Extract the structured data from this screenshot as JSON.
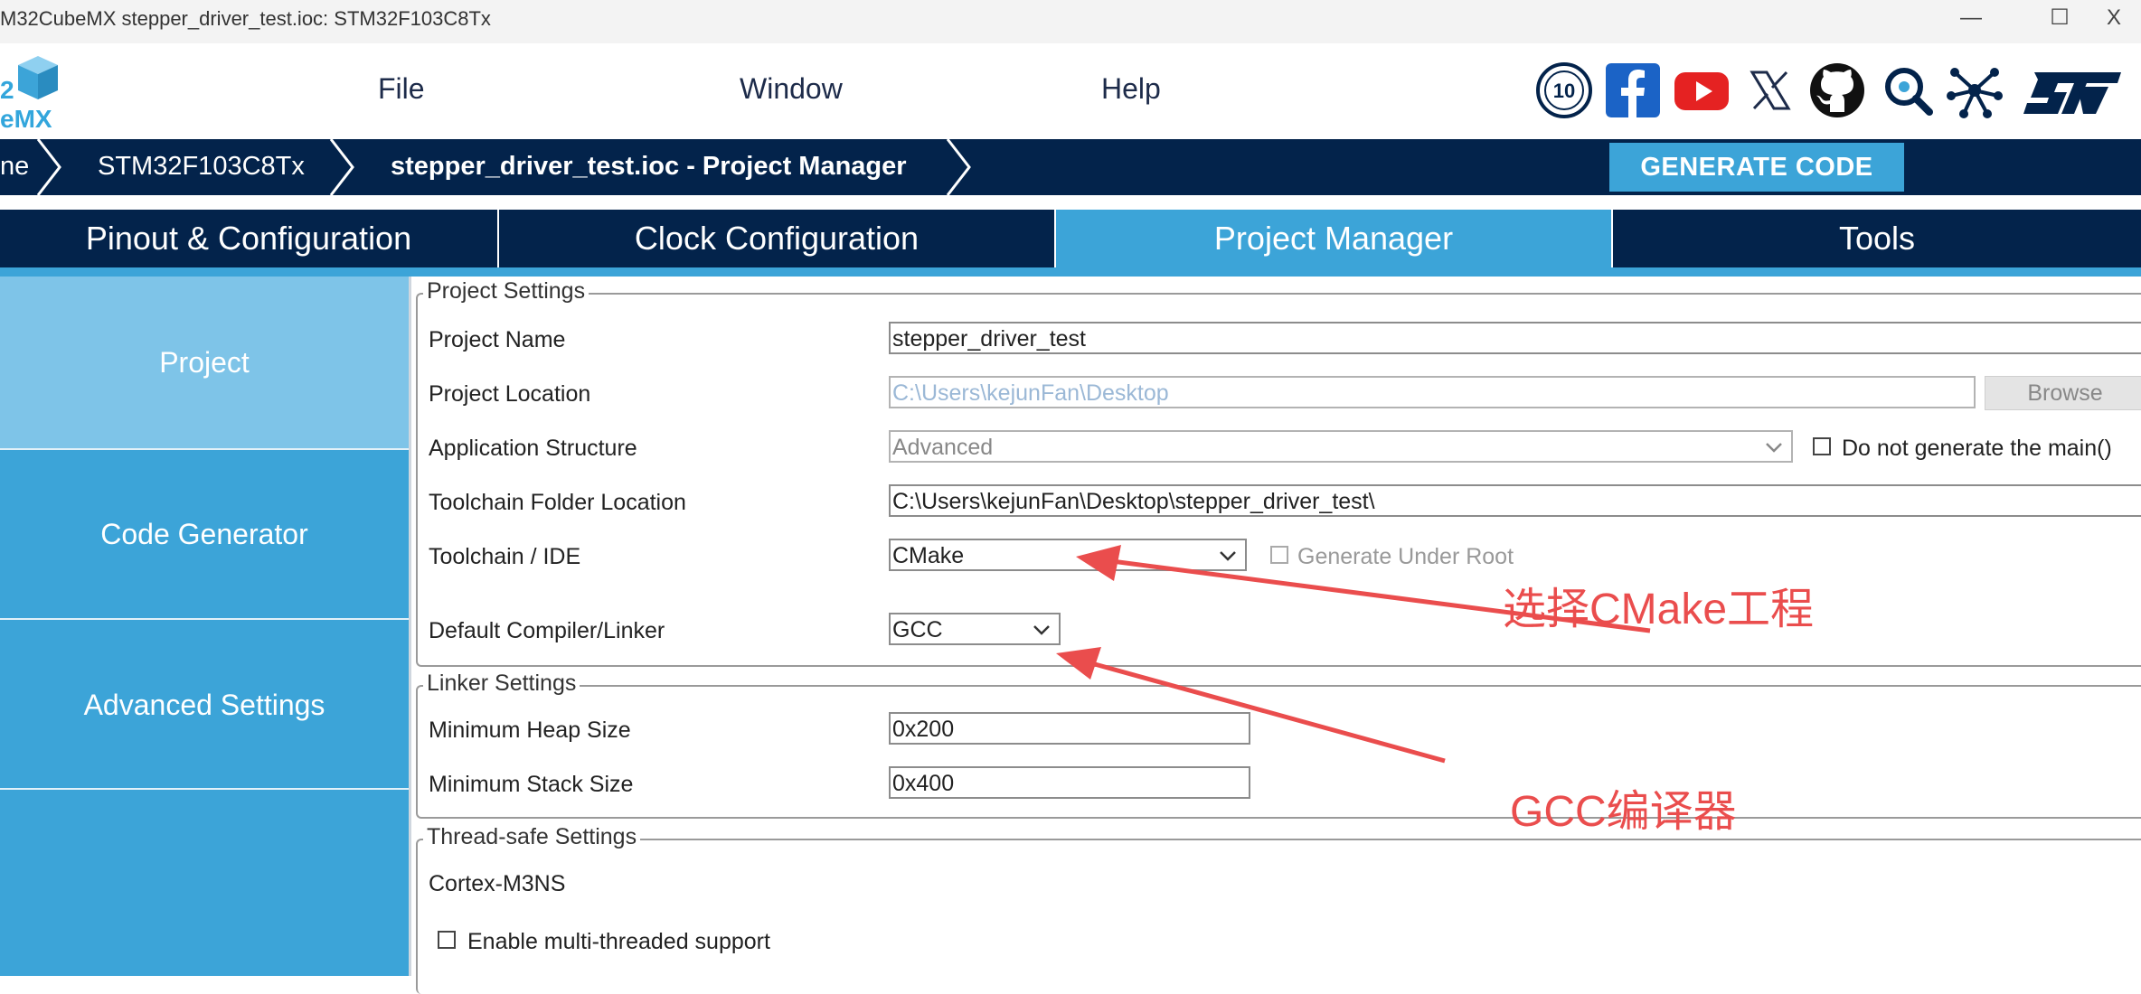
{
  "window": {
    "title": "M32CubeMX stepper_driver_test.ioc: STM32F103C8Tx",
    "minimize_glyph": "—",
    "maximize_glyph": "☐",
    "close_glyph": "X"
  },
  "logo": {
    "line1": "2",
    "line2": "eMX"
  },
  "menu": {
    "file": "File",
    "window": "Window",
    "help": "Help"
  },
  "social_icons": [
    "anniversary-10-icon",
    "facebook-icon",
    "youtube-icon",
    "x-twitter-icon",
    "github-icon",
    "community-search-icon",
    "network-icon",
    "st-logo-icon"
  ],
  "breadcrumb": {
    "home": "ne",
    "mcu": "STM32F103C8Tx",
    "current": "stepper_driver_test.ioc - Project Manager"
  },
  "generate_button": "GENERATE CODE",
  "tabs": [
    "Pinout & Configuration",
    "Clock Configuration",
    "Project Manager",
    "Tools"
  ],
  "active_tab": "Project Manager",
  "sidebar": {
    "items": [
      {
        "label": "Project"
      },
      {
        "label": "Code Generator"
      },
      {
        "label": "Advanced Settings"
      }
    ]
  },
  "project_settings": {
    "group_label": "Project Settings",
    "project_name_label": "Project Name",
    "project_name_value": "stepper_driver_test",
    "project_location_label": "Project Location",
    "project_location_value": "C:\\Users\\kejunFan\\Desktop",
    "browse_label": "Browse",
    "app_structure_label": "Application Structure",
    "app_structure_value": "Advanced",
    "no_main_label": "Do not generate the main()",
    "toolchain_folder_label": "Toolchain Folder Location",
    "toolchain_folder_value": "C:\\Users\\kejunFan\\Desktop\\stepper_driver_test\\",
    "toolchain_ide_label": "Toolchain / IDE",
    "toolchain_ide_value": "CMake",
    "generate_under_root_label": "Generate Under Root",
    "compiler_label": "Default Compiler/Linker",
    "compiler_value": "GCC"
  },
  "linker_settings": {
    "group_label": "Linker Settings",
    "heap_label": "Minimum Heap Size",
    "heap_value": "0x200",
    "stack_label": "Minimum Stack Size",
    "stack_value": "0x400"
  },
  "thread_safe": {
    "group_label": "Thread-safe Settings",
    "core_label": "Cortex-M3NS",
    "multithread_label": "Enable multi-threaded support"
  },
  "annotations": {
    "cmake_note": "选择CMake工程",
    "gcc_note": "GCC编译器",
    "color": "#ea4d4d"
  },
  "colors": {
    "navy": "#03234b",
    "accent": "#3ca4d8",
    "active_sidebar": "#7ec4e8"
  }
}
